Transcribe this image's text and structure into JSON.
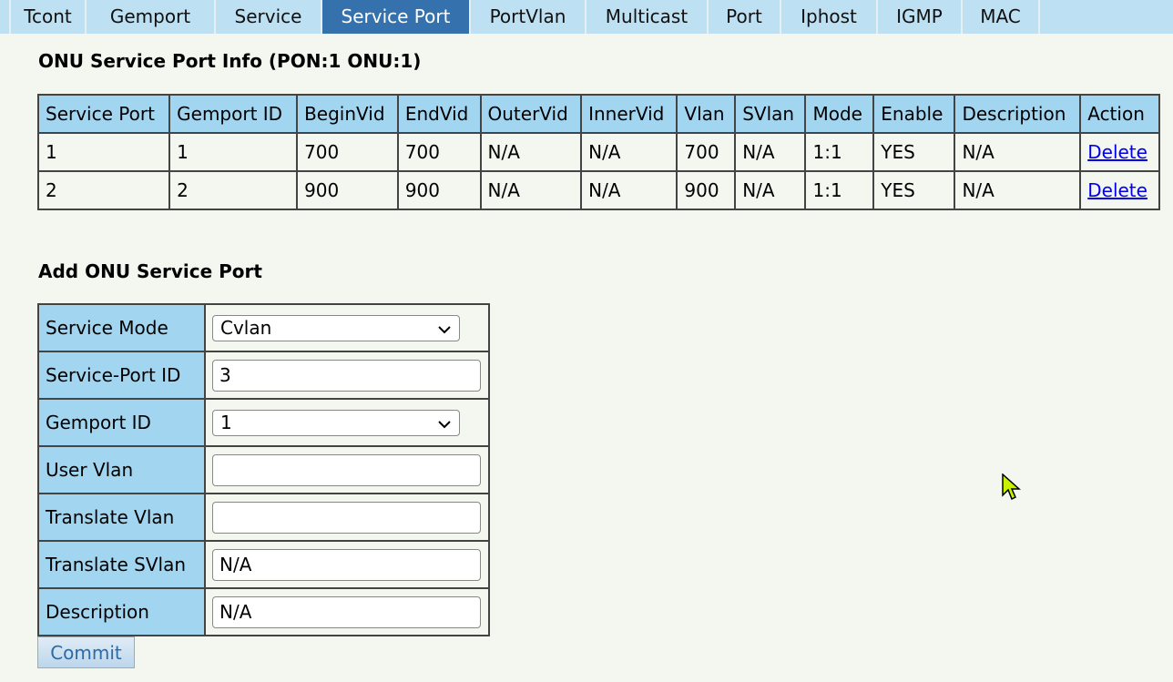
{
  "tabs": [
    {
      "label": ""
    },
    {
      "label": "Tcont"
    },
    {
      "label": "Gemport"
    },
    {
      "label": "Service"
    },
    {
      "label": "Service Port",
      "active": true
    },
    {
      "label": "PortVlan"
    },
    {
      "label": "Multicast"
    },
    {
      "label": "Port"
    },
    {
      "label": "Iphost"
    },
    {
      "label": "IGMP"
    },
    {
      "label": "MAC"
    }
  ],
  "info": {
    "title": "ONU Service Port Info (PON:1 ONU:1)",
    "columns": [
      "Service Port",
      "Gemport ID",
      "BeginVid",
      "EndVid",
      "OuterVid",
      "InnerVid",
      "Vlan",
      "SVlan",
      "Mode",
      "Enable",
      "Description",
      "Action"
    ],
    "rows": [
      [
        "1",
        "1",
        "700",
        "700",
        "N/A",
        "N/A",
        "700",
        "N/A",
        "1:1",
        "YES",
        "N/A",
        "Delete"
      ],
      [
        "2",
        "2",
        "900",
        "900",
        "N/A",
        "N/A",
        "900",
        "N/A",
        "1:1",
        "YES",
        "N/A",
        "Delete"
      ]
    ]
  },
  "form": {
    "title": "Add ONU Service Port",
    "service_mode": {
      "label": "Service Mode",
      "value": "Cvlan"
    },
    "service_port_id": {
      "label": "Service-Port ID",
      "value": "3"
    },
    "gemport_id": {
      "label": "Gemport ID",
      "value": "1"
    },
    "user_vlan": {
      "label": "User Vlan",
      "value": ""
    },
    "translate_vlan": {
      "label": "Translate Vlan",
      "value": ""
    },
    "translate_svlan": {
      "label": "Translate SVlan",
      "value": "N/A"
    },
    "description": {
      "label": "Description",
      "value": "N/A"
    },
    "commit_label": "Commit"
  },
  "colors": {
    "tab_active": "#3572ad",
    "tab": "#bde0f3",
    "header": "#a2d5f0",
    "link": "#0000ee"
  }
}
